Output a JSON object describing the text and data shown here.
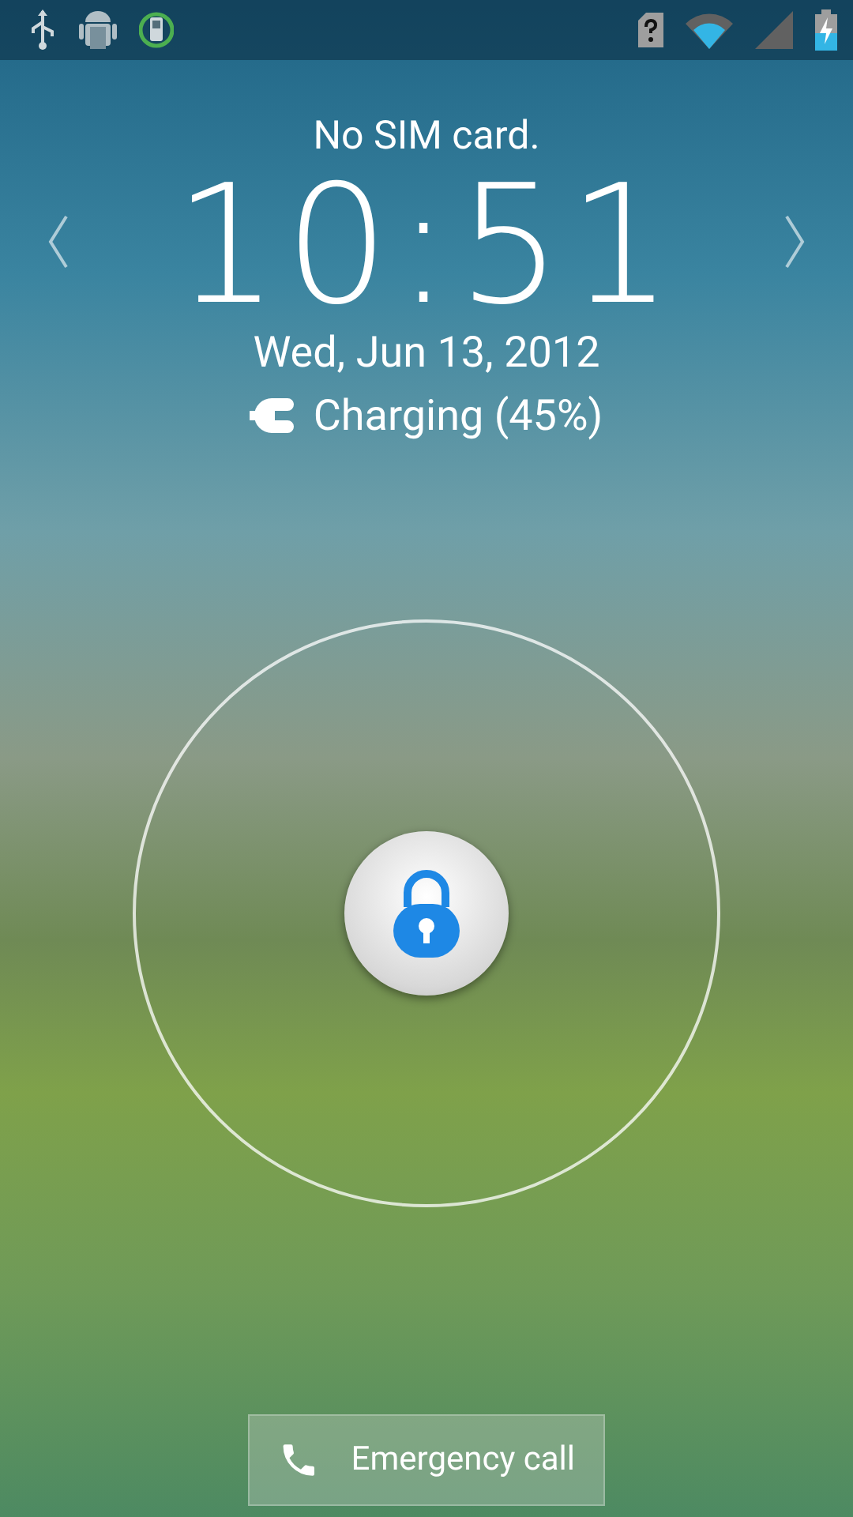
{
  "lock_screen": {
    "carrier": "No SIM card.",
    "time": "10:51",
    "date": "Wed, Jun 13, 2012",
    "charging": "Charging (45%)"
  },
  "emergency_button": {
    "label": "Emergency call"
  }
}
